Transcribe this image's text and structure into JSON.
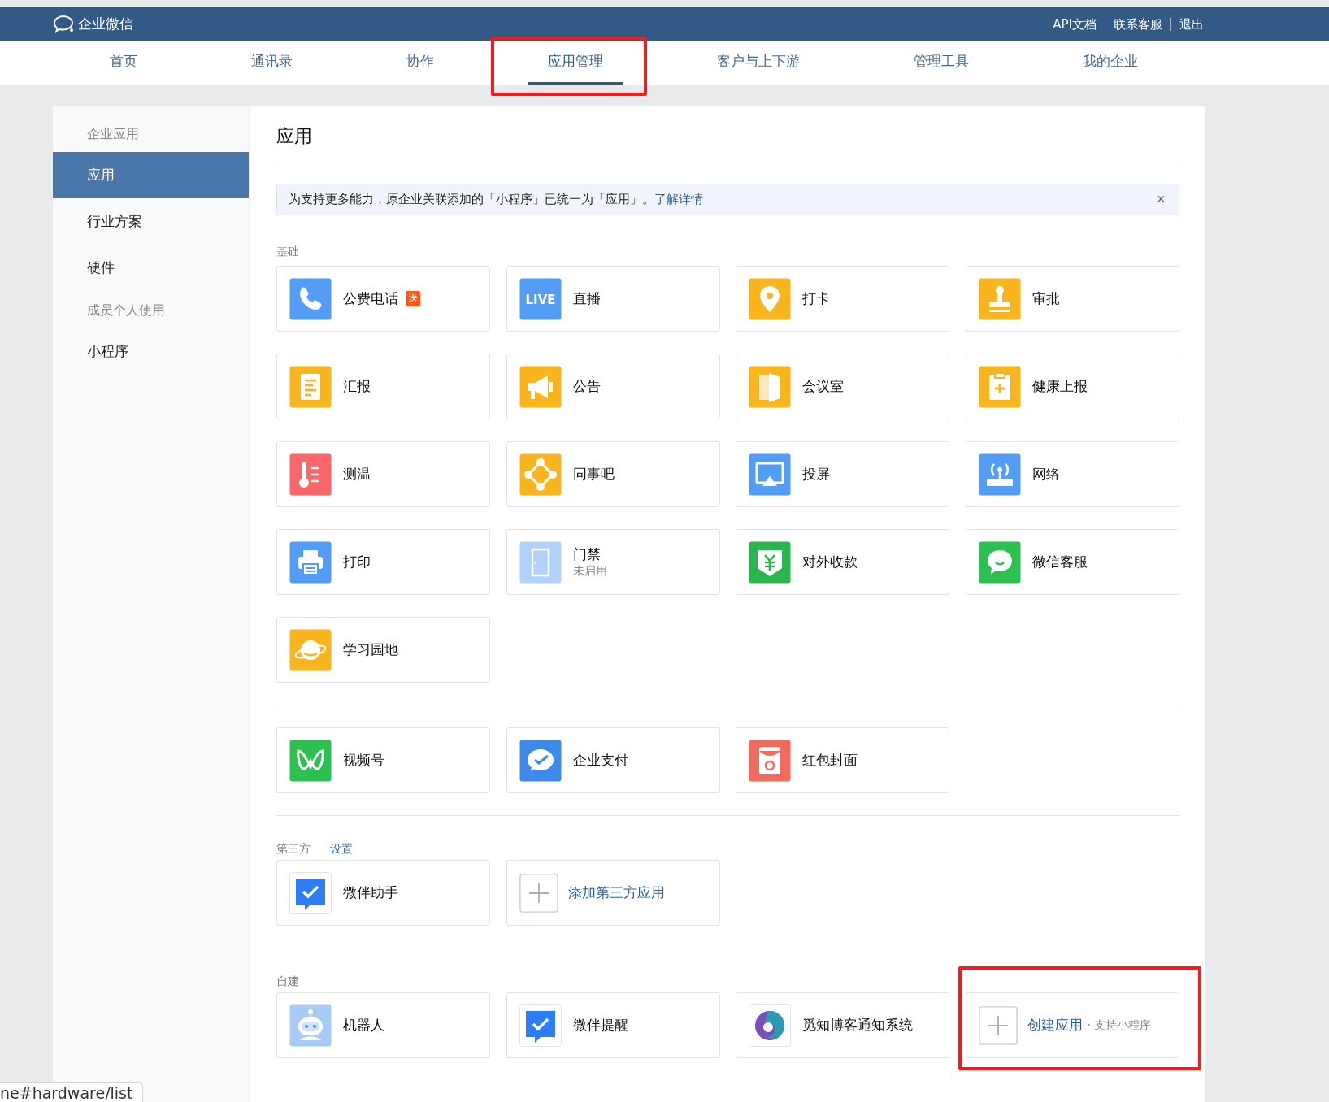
{
  "topbar": {
    "brand": "企业微信",
    "links": [
      "API文档",
      "联系客服",
      "退出"
    ]
  },
  "nav": [
    {
      "label": "首页",
      "selected": false,
      "highlighted": false
    },
    {
      "label": "通讯录",
      "selected": false,
      "highlighted": false
    },
    {
      "label": "协作",
      "selected": false,
      "highlighted": false
    },
    {
      "label": "应用管理",
      "selected": true,
      "highlighted": true
    },
    {
      "label": "客户与上下游",
      "selected": false,
      "highlighted": false
    },
    {
      "label": "管理工具",
      "selected": false,
      "highlighted": false
    },
    {
      "label": "我的企业",
      "selected": false,
      "highlighted": false
    }
  ],
  "sidebar": [
    {
      "kind": "heading",
      "label": "企业应用"
    },
    {
      "kind": "item",
      "label": "应用",
      "selected": true
    },
    {
      "kind": "item",
      "label": "行业方案",
      "selected": false
    },
    {
      "kind": "item",
      "label": "硬件",
      "selected": false
    },
    {
      "kind": "heading",
      "label": "成员个人使用"
    },
    {
      "kind": "item",
      "label": "小程序",
      "selected": false
    }
  ],
  "page_title": "应用",
  "notice": {
    "text": "为支持更多能力，原企业关联添加的「小程序」已统一为「应用」。",
    "link": "了解详情",
    "close": "×"
  },
  "sections": [
    {
      "title": "基础",
      "apps": [
        {
          "kind": "app",
          "name": "公费电话",
          "badge": "送",
          "disabled": false
        },
        {
          "kind": "app",
          "icon_text": "LIVE",
          "name": "直播",
          "disabled": false
        },
        {
          "kind": "app",
          "name": "打卡",
          "disabled": false
        },
        {
          "kind": "app",
          "name": "审批",
          "disabled": false
        },
        {
          "kind": "app",
          "name": "汇报",
          "disabled": false
        },
        {
          "kind": "app",
          "name": "公告",
          "disabled": false
        },
        {
          "kind": "app",
          "name": "会议室",
          "disabled": false
        },
        {
          "kind": "app",
          "name": "健康上报",
          "disabled": false
        },
        {
          "kind": "app",
          "name": "测温",
          "disabled": false
        },
        {
          "kind": "app",
          "name": "同事吧",
          "disabled": false
        },
        {
          "kind": "app",
          "name": "投屏",
          "disabled": false
        },
        {
          "kind": "app",
          "name": "网络",
          "disabled": false
        },
        {
          "kind": "app",
          "name": "打印",
          "disabled": false
        },
        {
          "kind": "app",
          "name": "门禁",
          "status": "未启用",
          "disabled": true
        },
        {
          "kind": "app",
          "name": "对外收款",
          "disabled": false
        },
        {
          "kind": "app",
          "name": "微信客服",
          "disabled": false
        },
        {
          "kind": "app",
          "name": "学习园地",
          "disabled": false
        }
      ]
    },
    {
      "apps": [
        {
          "kind": "app",
          "name": "视频号",
          "disabled": false
        },
        {
          "kind": "app",
          "name": "企业支付",
          "disabled": false
        },
        {
          "kind": "app",
          "name": "红包封面",
          "disabled": false
        }
      ]
    },
    {
      "title": "第三方",
      "link": "设置",
      "apps": [
        {
          "kind": "app",
          "name": "微伴助手",
          "disabled": false
        },
        {
          "kind": "add",
          "name": "添加第三方应用",
          "highlighted": false
        }
      ]
    },
    {
      "title": "自建",
      "apps": [
        {
          "kind": "app",
          "name": "机器人",
          "disabled": false
        },
        {
          "kind": "app",
          "name": "微伴提醒",
          "disabled": false
        },
        {
          "kind": "app",
          "name": "觅知博客通知系统",
          "disabled": false
        },
        {
          "kind": "add",
          "name": "创建应用",
          "note": "· 支持小程序",
          "highlighted": true
        }
      ]
    }
  ],
  "status_url": "ne#hardware/list"
}
